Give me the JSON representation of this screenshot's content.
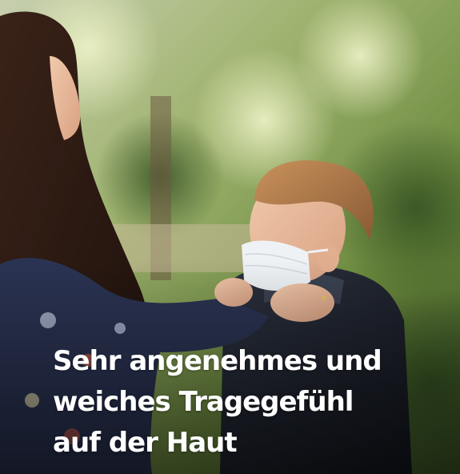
{
  "image": {
    "description_icon": "photo-mother-fitting-face-mask-on-child"
  },
  "caption": {
    "lines": [
      "Sehr angenehmes und",
      "weiches Tragegefühl",
      "auf der Haut"
    ]
  },
  "colors": {
    "caption_text": "#ffffff",
    "foliage": "#6f8a4a",
    "mask": "#eef2f5",
    "jacket": "#1f2430"
  }
}
